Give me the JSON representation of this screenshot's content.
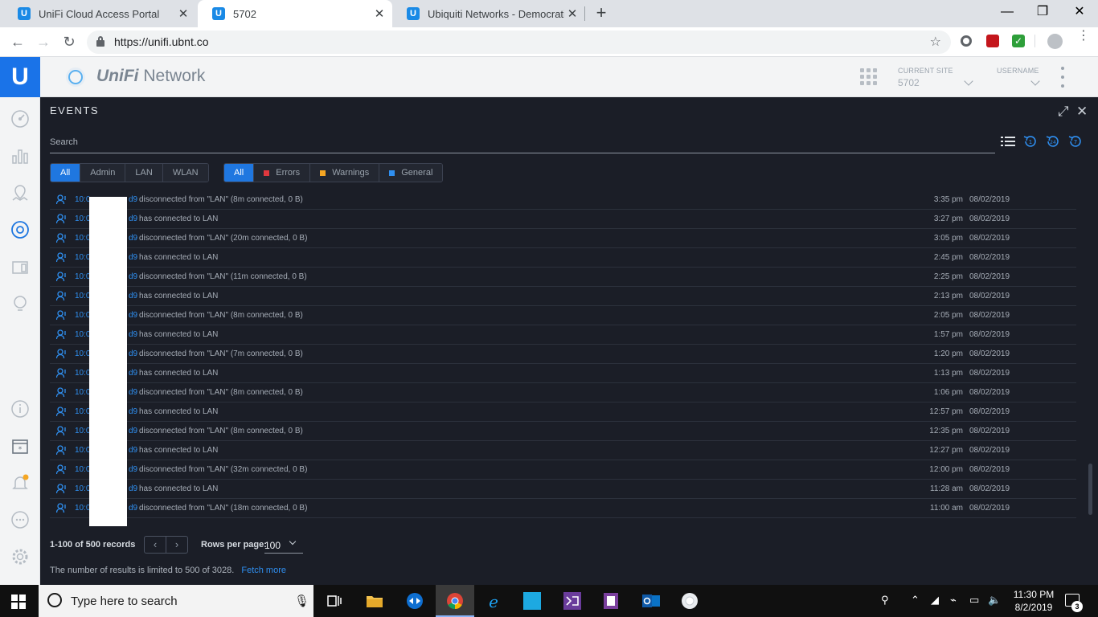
{
  "browser": {
    "tabs": [
      {
        "title": "UniFi Cloud Access Portal",
        "favicon": "U"
      },
      {
        "title": "5702",
        "favicon": "U"
      },
      {
        "title": "Ubiquiti Networks - Democratizin",
        "favicon": "U"
      }
    ],
    "url": "https://unifi.ubnt.co",
    "close_glyph": "✕",
    "new_tab_glyph": "+",
    "minimize_glyph": "—",
    "maximize_glyph": "❐",
    "window_close_glyph": "✕"
  },
  "app": {
    "brand_uni": "UniFi",
    "brand_rest": "Network",
    "logo_letter": "U",
    "current_site_label": "CURRENT SITE",
    "current_site_value": "5702",
    "username_label": "USERNAME",
    "accent": "#1f77e0"
  },
  "events": {
    "title": "EVENTS",
    "expand_glyph": "⤢",
    "close_glyph": "✕",
    "search_placeholder": "Search",
    "category_filters": [
      "All",
      "Admin",
      "LAN",
      "WLAN"
    ],
    "severity_filters": [
      {
        "label": "All",
        "color": ""
      },
      {
        "label": "Errors",
        "color": "#e0383e"
      },
      {
        "label": "Warnings",
        "color": "#f5a623"
      },
      {
        "label": "General",
        "color": "#2f8ff0"
      }
    ],
    "rows": [
      {
        "id_prefix": "10:0",
        "id_suffix": "d9",
        "message": "disconnected from \"LAN\" (8m connected, 0 B)",
        "time": "3:35 pm",
        "date": "08/02/2019"
      },
      {
        "id_prefix": "10:0",
        "id_suffix": "d9",
        "message": "has connected to LAN",
        "time": "3:27 pm",
        "date": "08/02/2019"
      },
      {
        "id_prefix": "10:0",
        "id_suffix": "d9",
        "message": "disconnected from \"LAN\" (20m connected, 0 B)",
        "time": "3:05 pm",
        "date": "08/02/2019"
      },
      {
        "id_prefix": "10:0",
        "id_suffix": "d9",
        "message": "has connected to LAN",
        "time": "2:45 pm",
        "date": "08/02/2019"
      },
      {
        "id_prefix": "10:0",
        "id_suffix": "d9",
        "message": "disconnected from \"LAN\" (11m connected, 0 B)",
        "time": "2:25 pm",
        "date": "08/02/2019"
      },
      {
        "id_prefix": "10:0",
        "id_suffix": "d9",
        "message": "has connected to LAN",
        "time": "2:13 pm",
        "date": "08/02/2019"
      },
      {
        "id_prefix": "10:0",
        "id_suffix": "d9",
        "message": "disconnected from \"LAN\" (8m connected, 0 B)",
        "time": "2:05 pm",
        "date": "08/02/2019"
      },
      {
        "id_prefix": "10:0",
        "id_suffix": "d9",
        "message": "has connected to LAN",
        "time": "1:57 pm",
        "date": "08/02/2019"
      },
      {
        "id_prefix": "10:0",
        "id_suffix": "d9",
        "message": "disconnected from \"LAN\" (7m connected, 0 B)",
        "time": "1:20 pm",
        "date": "08/02/2019"
      },
      {
        "id_prefix": "10:0",
        "id_suffix": "d9",
        "message": "has connected to LAN",
        "time": "1:13 pm",
        "date": "08/02/2019"
      },
      {
        "id_prefix": "10:0",
        "id_suffix": "d9",
        "message": "disconnected from \"LAN\" (8m connected, 0 B)",
        "time": "1:06 pm",
        "date": "08/02/2019"
      },
      {
        "id_prefix": "10:0",
        "id_suffix": "d9",
        "message": "has connected to LAN",
        "time": "12:57 pm",
        "date": "08/02/2019"
      },
      {
        "id_prefix": "10:0",
        "id_suffix": "d9",
        "message": "disconnected from \"LAN\" (8m connected, 0 B)",
        "time": "12:35 pm",
        "date": "08/02/2019"
      },
      {
        "id_prefix": "10:0",
        "id_suffix": "d9",
        "message": "has connected to LAN",
        "time": "12:27 pm",
        "date": "08/02/2019"
      },
      {
        "id_prefix": "10:0",
        "id_suffix": "d9",
        "message": "disconnected from \"LAN\" (32m connected, 0 B)",
        "time": "12:00 pm",
        "date": "08/02/2019"
      },
      {
        "id_prefix": "10:0",
        "id_suffix": "d9",
        "message": "has connected to LAN",
        "time": "11:28 am",
        "date": "08/02/2019"
      },
      {
        "id_prefix": "10:0",
        "id_suffix": "d9",
        "message": "disconnected from \"LAN\" (18m connected, 0 B)",
        "time": "11:00 am",
        "date": "08/02/2019"
      }
    ],
    "records_text": "1-100 of 500 records",
    "rows_per_page_label": "Rows per page:",
    "rows_per_page_value": "100",
    "limit_text": "The number of results is limited to 500 of 3028.",
    "fetch_more": "Fetch more"
  },
  "taskbar": {
    "search_placeholder": "Type here to search",
    "time": "11:30 PM",
    "date": "8/2/2019",
    "notification_count": "3"
  }
}
